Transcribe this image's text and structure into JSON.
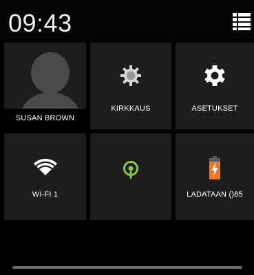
{
  "status": {
    "time": "09:43"
  },
  "menu": {
    "icon": "list-menu-icon"
  },
  "tiles": {
    "user": {
      "label": "SUSAN BROWN",
      "icon": "user-avatar-icon"
    },
    "brightness": {
      "label": "KIRKKAUS",
      "icon": "brightness-icon"
    },
    "settings": {
      "label": "ASETUKSET",
      "icon": "gear-icon"
    },
    "wifi": {
      "label": "WI-FI 1",
      "icon": "wifi-icon"
    },
    "location": {
      "label": "",
      "icon": "location-icon",
      "color": "#8cc63f"
    },
    "battery": {
      "label": "LADATAAN ()85",
      "icon": "battery-charging-icon",
      "color": "#e8782a"
    }
  },
  "colors": {
    "tile_bg": "#1d1d1d",
    "background": "#000000",
    "accent_green": "#8cc63f",
    "accent_orange": "#e8782a"
  }
}
